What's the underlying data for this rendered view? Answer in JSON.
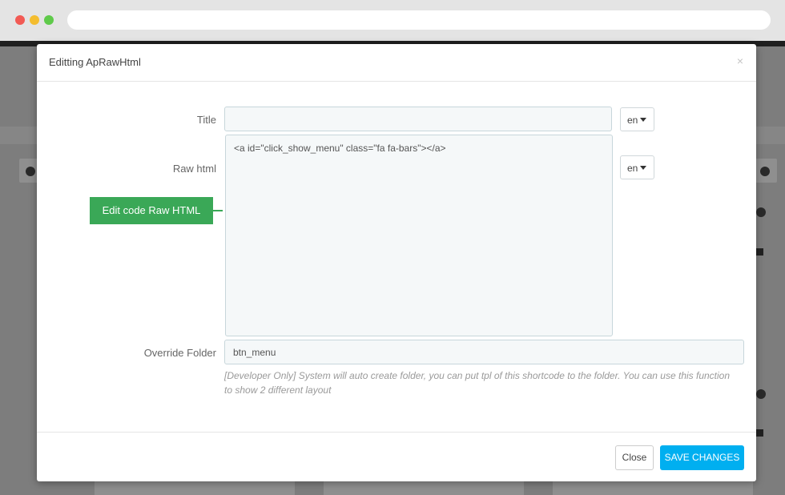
{
  "modal": {
    "title": "Editting ApRawHtml",
    "close_symbol": "×"
  },
  "form": {
    "title_label": "Title",
    "title_value": "",
    "title_lang": "en",
    "raw_html_label": "Raw html",
    "raw_html_value": "<a id=\"click_show_menu\" class=\"fa fa-bars\"></a>",
    "raw_html_lang": "en",
    "override_folder_label": "Override Folder",
    "override_folder_value": "btn_menu",
    "help_text": "[Developer Only] System will auto create folder, you can put tpl of this shortcode to the folder. You can use this function to show 2 different layout"
  },
  "callout": {
    "text": "Edit code Raw HTML",
    "color": "#3aa857"
  },
  "footer": {
    "close_label": "Close",
    "save_label": "SAVE CHANGES",
    "save_color": "#00aff0"
  }
}
